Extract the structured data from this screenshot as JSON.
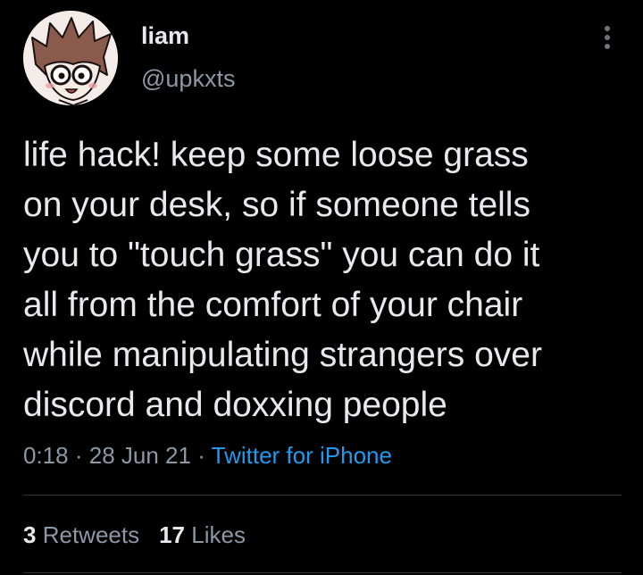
{
  "user": {
    "display_name": "liam",
    "handle": "@upkxts",
    "avatar_icon": "avatar-cartoon-character-icon"
  },
  "tweet": {
    "text": "life hack! keep some loose grass\non your desk, so if someone tells\nyou to \"touch grass\" you can do it\nall from the comfort of your chair\nwhile manipulating strangers over\ndiscord and doxxing people",
    "time": "0:18",
    "date": "28 Jun 21",
    "separator": "·",
    "source": "Twitter for iPhone"
  },
  "stats": {
    "retweets_count": "3",
    "retweets_label": "Retweets",
    "likes_count": "17",
    "likes_label": "Likes"
  },
  "menu": {
    "icon": "more-vertical-icon"
  },
  "colors": {
    "background": "#000000",
    "primary_text": "#e7e9ea",
    "secondary_text": "#8b98a5",
    "link": "#1d9bf0",
    "divider": "#2f3336"
  }
}
